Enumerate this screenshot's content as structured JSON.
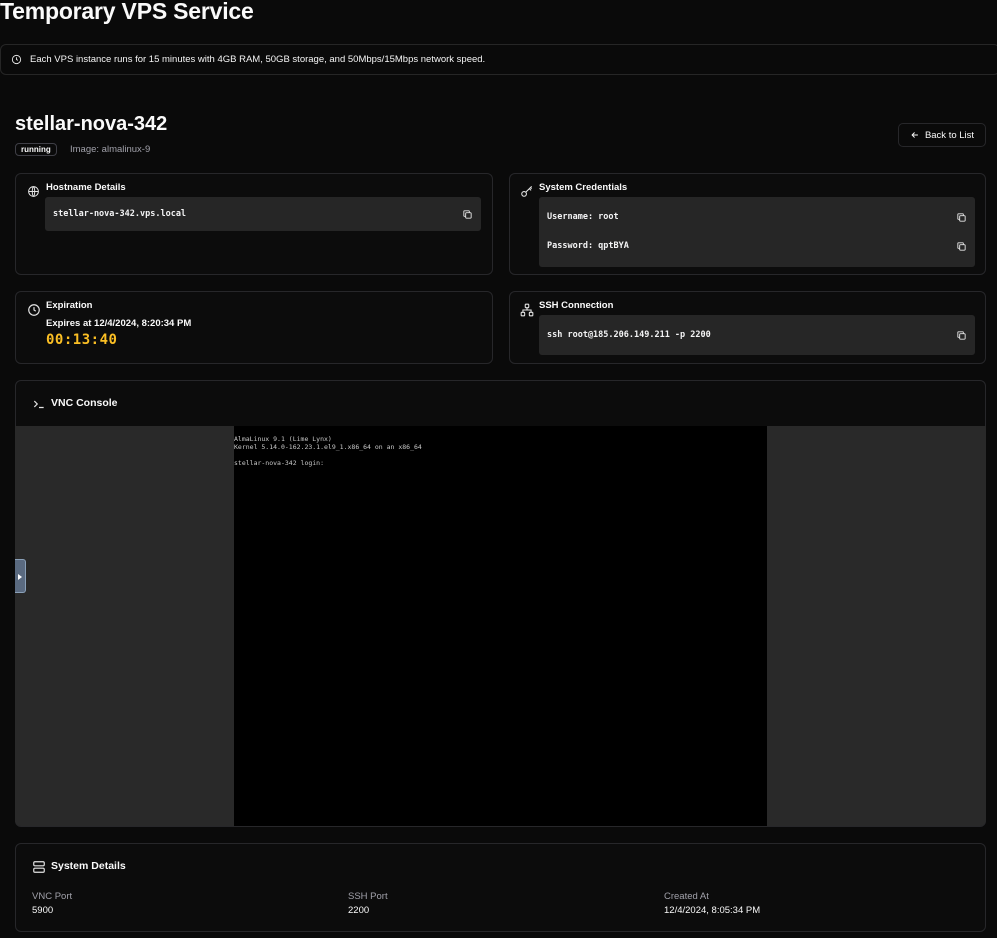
{
  "app": {
    "title": "Temporary VPS Service",
    "notice": "Each VPS instance runs for 15 minutes with 4GB RAM, 50GB storage, and 50Mbps/15Mbps network speed."
  },
  "server": {
    "name": "stellar-nova-342",
    "status": "running",
    "image": "Image: almalinux-9",
    "back_label": "Back to List"
  },
  "hostname": {
    "title": "Hostname Details",
    "value": "stellar-nova-342.vps.local"
  },
  "credentials": {
    "title": "System Credentials",
    "username": "Username: root",
    "password": "Password: qptBYA"
  },
  "expiration": {
    "title": "Expiration",
    "expires_at": "Expires at 12/4/2024, 8:20:34 PM",
    "countdown": "00:13:40"
  },
  "ssh": {
    "title": "SSH Connection",
    "command": "ssh root@185.206.149.211 -p 2200"
  },
  "vnc": {
    "title": "VNC Console",
    "lines": [
      "AlmaLinux 9.1 (Lime Lynx)",
      "Kernel 5.14.0-162.23.1.el9_1.x86_64 on an x86_64",
      "",
      "stellar-nova-342 login:"
    ]
  },
  "system_details": {
    "title": "System Details",
    "vnc_port_label": "VNC Port",
    "vnc_port": "5900",
    "ssh_port_label": "SSH Port",
    "ssh_port": "2200",
    "created_label": "Created At",
    "created_at": "12/4/2024, 8:05:34 PM"
  },
  "colors": {
    "background": "#0a0a0a",
    "card_border": "#27272a",
    "code_background": "#262626",
    "countdown": "#fbbf24"
  }
}
